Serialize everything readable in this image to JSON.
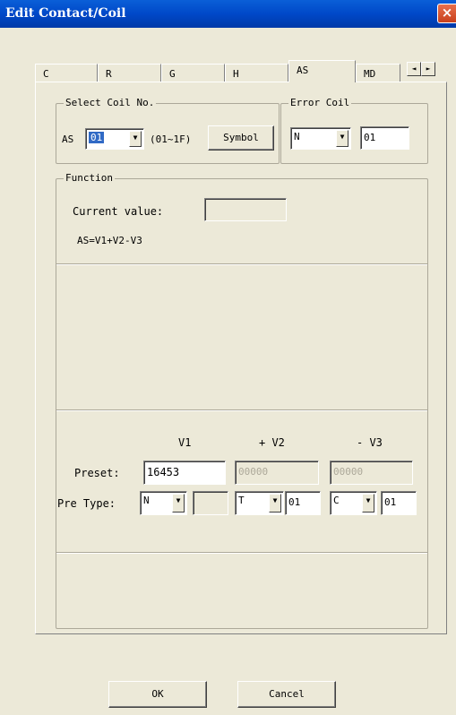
{
  "window": {
    "title": "Edit Contact/Coil",
    "close_icon": "×"
  },
  "tabs": [
    {
      "label": "C"
    },
    {
      "label": "R"
    },
    {
      "label": "G"
    },
    {
      "label": "H"
    },
    {
      "label": "AS"
    },
    {
      "label": "MD"
    }
  ],
  "tab_scroll": {
    "left": "◄",
    "right": "►"
  },
  "select_coil": {
    "legend": "Select Coil No.",
    "prefix": "AS",
    "value": "01",
    "range": "(01~1F)",
    "symbol_button": "Symbol"
  },
  "error_coil": {
    "legend": "Error Coil",
    "type": "N",
    "value": "01"
  },
  "function": {
    "legend": "Function",
    "current_value_label": "Current value:",
    "current_value": "",
    "formula": "AS=V1+V2-V3"
  },
  "operands": {
    "v1_header": "V1",
    "v2_header": "+ V2",
    "v3_header": "- V3",
    "preset_label": "Preset:",
    "preset_v1": "16453",
    "preset_v2": "00000",
    "preset_v3": "00000",
    "pretype_label": "Pre Type:",
    "type_v1": "N",
    "type_v1_value": "",
    "type_v2": "T",
    "type_v2_value": "01",
    "type_v3": "C",
    "type_v3_value": "01"
  },
  "footer": {
    "ok": "OK",
    "cancel": "Cancel"
  },
  "icons": {
    "dropdown": "▼"
  }
}
